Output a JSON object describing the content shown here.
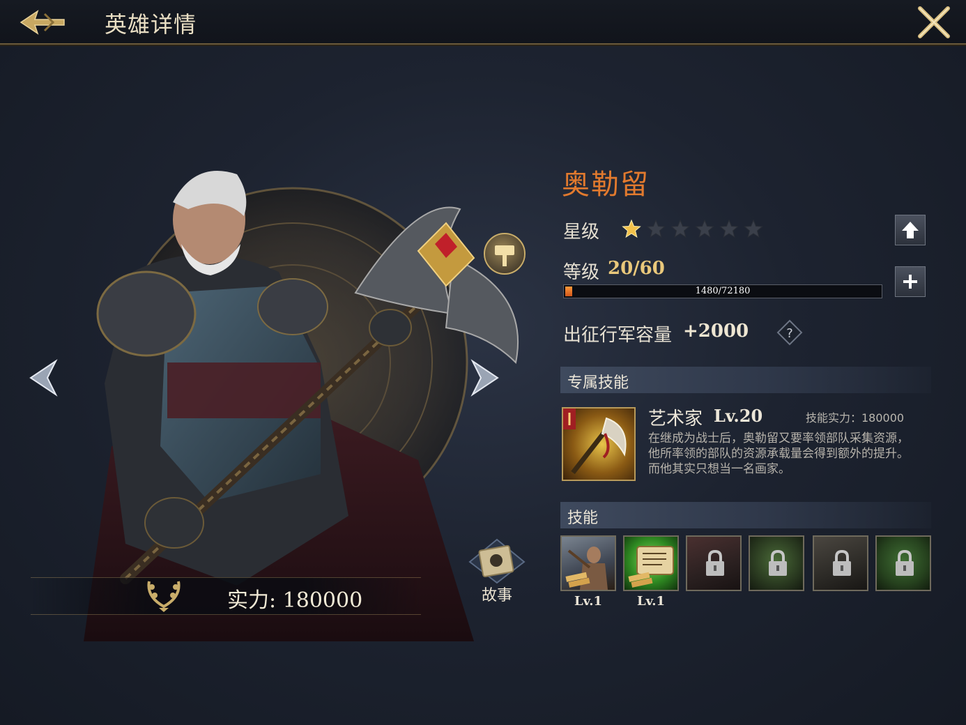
{
  "header": {
    "title": "英雄详情"
  },
  "hero": {
    "name": "奥勒留",
    "power_label": "实力: 180000",
    "story_label": "故事"
  },
  "stats": {
    "star_label": "星级",
    "stars_filled": 1,
    "stars_total": 6,
    "level_label": "等级",
    "level_value": "20/60",
    "exp_text": "1480/72180",
    "exp_fraction": 0.0205,
    "capacity_label": "出征行军容量",
    "capacity_value": "+2000",
    "help_symbol": "?"
  },
  "exclusive_skill": {
    "section_title": "专属技能",
    "name": "艺术家",
    "level": "Lv.20",
    "power": "技能实力：180000",
    "description": "在继成为战士后，奥勒留又要率领部队采集资源，他所率领的部队的资源承载量会得到额外的提升。而他其实只想当一名画家。"
  },
  "skills": {
    "section_title": "技能",
    "slots": [
      {
        "label": "Lv.1",
        "locked": false,
        "icon": "lumberjack-icon"
      },
      {
        "label": "Lv.1",
        "locked": false,
        "icon": "scroll-icon"
      },
      {
        "label": "",
        "locked": true,
        "icon": "lock-icon"
      },
      {
        "label": "",
        "locked": true,
        "icon": "lock-icon"
      },
      {
        "label": "",
        "locked": true,
        "icon": "lock-icon"
      },
      {
        "label": "",
        "locked": true,
        "icon": "lock-icon"
      }
    ]
  },
  "colors": {
    "accent_orange": "#e27a2e",
    "gold": "#c9ad6a",
    "level_gold": "#e9c87b"
  }
}
